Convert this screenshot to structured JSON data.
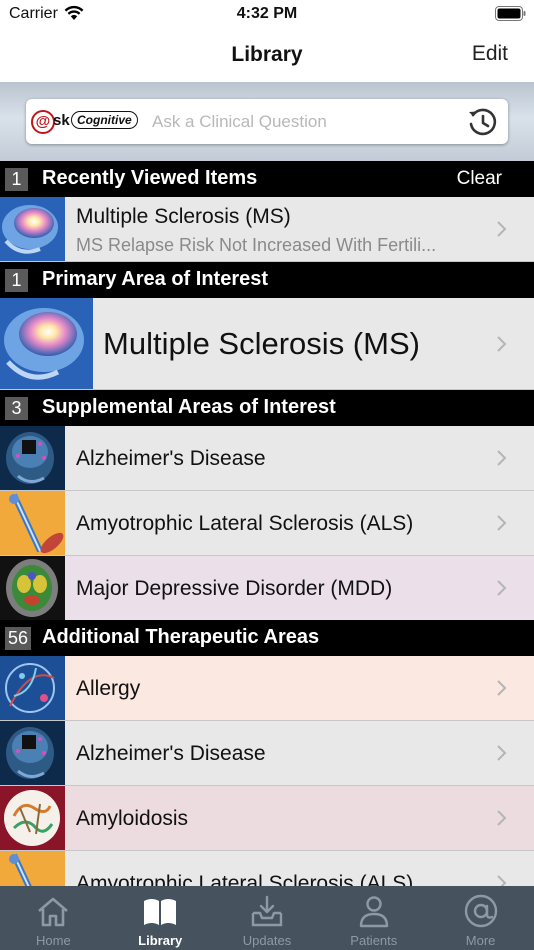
{
  "status_bar": {
    "carrier": "Carrier",
    "time": "4:32 PM"
  },
  "nav": {
    "title": "Library",
    "edit_label": "Edit"
  },
  "search": {
    "logo_at": "@",
    "logo_sk": "sk",
    "logo_cognitive": "Cognitive",
    "placeholder": "Ask a Clinical Question"
  },
  "sections": {
    "recent": {
      "count": "1",
      "title": "Recently Viewed Items",
      "clear_label": "Clear"
    },
    "primary": {
      "count": "1",
      "title": "Primary Area of Interest"
    },
    "supplemental": {
      "count": "3",
      "title": "Supplemental Areas of Interest"
    },
    "additional": {
      "count": "56",
      "title": "Additional Therapeutic Areas"
    }
  },
  "recent_items": [
    {
      "title": "Multiple Sclerosis (MS)",
      "subtitle": "MS Relapse Risk Not Increased With Fertili..."
    }
  ],
  "primary_item": {
    "title": "Multiple Sclerosis (MS)"
  },
  "supplemental_items": [
    {
      "title": "Alzheimer's Disease",
      "bg": "#e8e8e8"
    },
    {
      "title": "Amyotrophic Lateral Sclerosis (ALS)",
      "bg": "#e8e8e8"
    },
    {
      "title": "Major Depressive Disorder (MDD)",
      "bg": "#ebe0ea"
    }
  ],
  "additional_items": [
    {
      "title": "Allergy",
      "bg": "#fbe8e0"
    },
    {
      "title": "Alzheimer's Disease",
      "bg": "#e8e8e8"
    },
    {
      "title": "Amyloidosis",
      "bg": "#ecdcdf"
    },
    {
      "title": "Amyotrophic Lateral Sclerosis (ALS)",
      "bg": "#e8e8e8"
    }
  ],
  "tabs": [
    {
      "label": "Home",
      "icon": "home-icon"
    },
    {
      "label": "Library",
      "icon": "book-icon",
      "active": true
    },
    {
      "label": "Updates",
      "icon": "inbox-download-icon"
    },
    {
      "label": "Patients",
      "icon": "person-icon"
    },
    {
      "label": "More",
      "icon": "at-sign-icon"
    }
  ],
  "colors": {
    "section_header_bg": "#000000",
    "tab_bar_bg": "#46525d",
    "logo_red": "#c0161a"
  }
}
